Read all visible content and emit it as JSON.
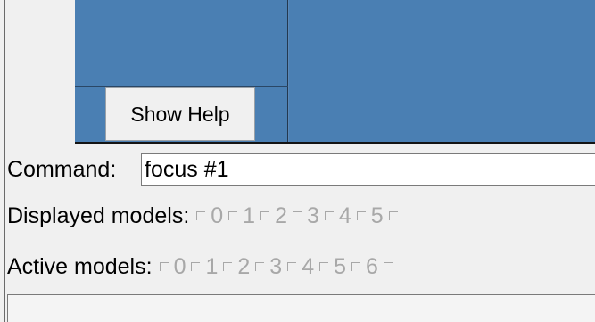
{
  "help_button": {
    "label": "Show Help"
  },
  "command": {
    "label": "Command:",
    "value": "focus #1"
  },
  "displayed_models": {
    "label": "Displayed models:",
    "models": [
      "0",
      "1",
      "2",
      "3",
      "4",
      "5",
      ""
    ]
  },
  "active_models": {
    "label": "Active models:",
    "models": [
      "0",
      "1",
      "2",
      "3",
      "4",
      "5",
      "6",
      ""
    ]
  },
  "colors": {
    "viewer_blue": "#4a7fb3",
    "panel_gray": "#f0f0f0",
    "disabled_text": "#a8a8a8"
  }
}
